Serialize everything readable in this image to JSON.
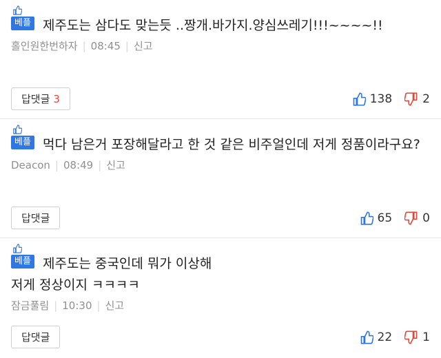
{
  "best_label": "베플",
  "report_label": "신고",
  "reply_label": "답댓글",
  "colors": {
    "best_badge": "#2f78e4",
    "like": "#2f78e4",
    "dislike": "#e0493a",
    "reply_count": "#e0493a"
  },
  "comments": [
    {
      "text": "제주도는 삼다도 맞는듯 ..짱개.바가지.양심쓰레기!!!~~~~!!",
      "author": "홀인원한번하자",
      "time": "08:45",
      "reply_count": "3",
      "likes": "138",
      "dislikes": "2"
    },
    {
      "text": "먹다 남은거 포장해달라고 한 것 같은 비주얼인데 저게 정품이라구요?",
      "author": "Deacon",
      "time": "08:49",
      "reply_count": "",
      "likes": "65",
      "dislikes": "0"
    },
    {
      "text": "제주도는 중국인데 뭐가 이상해\n저게 정상이지 ㅋㅋㅋㅋ",
      "author": "잠금풀림",
      "time": "10:30",
      "reply_count": "",
      "likes": "22",
      "dislikes": "1"
    }
  ]
}
